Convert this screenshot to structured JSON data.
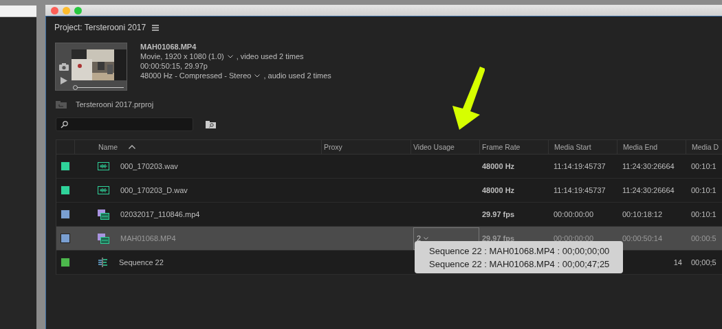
{
  "panel": {
    "title": "Project: Tersterooni 2017"
  },
  "clip": {
    "name": "MAH01068.MP4",
    "video_info": "Movie, 1920 x 1080 (1.0)",
    "video_usage": ", video used 2 times",
    "timing": "00:00:50:15, 29.97p",
    "audio_info": "48000 Hz - Compressed - Stereo",
    "audio_usage": ", audio used 2 times",
    "level": 0
  },
  "project_file": "Tersterooni 2017.prproj",
  "table": {
    "columns": [
      "Name",
      "Proxy",
      "Video Usage",
      "Frame Rate",
      "Media Start",
      "Media End",
      "Media D"
    ],
    "rows": [
      {
        "color": "#2fd39a",
        "kind": "audio",
        "name": "000_170203.wav",
        "frame_rate": "48000 Hz",
        "media_start": "11:14:19:45737",
        "media_end": "11:24:30:26664",
        "media_duration": "00:10:1",
        "selected": false
      },
      {
        "color": "#2fd39a",
        "kind": "audio",
        "name": "000_170203_D.wav",
        "frame_rate": "48000 Hz",
        "media_start": "11:14:19:45737",
        "media_end": "11:24:30:26664",
        "media_duration": "00:10:1",
        "selected": false
      },
      {
        "color": "#7a9fd1",
        "kind": "video",
        "name": "02032017_110846.mp4",
        "frame_rate": "29.97 fps",
        "media_start": "00:00:00:00",
        "media_end": "00:10:18:12",
        "media_duration": "00:10:1",
        "selected": false
      },
      {
        "color": "#7a9fd1",
        "kind": "video",
        "name": "MAH01068.MP4",
        "video_usage": "2",
        "frame_rate": "29.97 fps",
        "media_start": "00:00:00:00",
        "media_end": "00:00:50:14",
        "media_duration": "00:00:5",
        "selected": true
      },
      {
        "color": "#4cb84c",
        "kind": "sequence",
        "name": "Sequence 22",
        "media_end": "14",
        "media_duration": "00;00;5",
        "selected": false
      }
    ]
  },
  "tooltip": {
    "lines": [
      "Sequence 22 : MAH01068.MP4 : 00;00;00;00",
      "Sequence 22 : MAH01068.MP4 : 00;00;47;25"
    ]
  }
}
